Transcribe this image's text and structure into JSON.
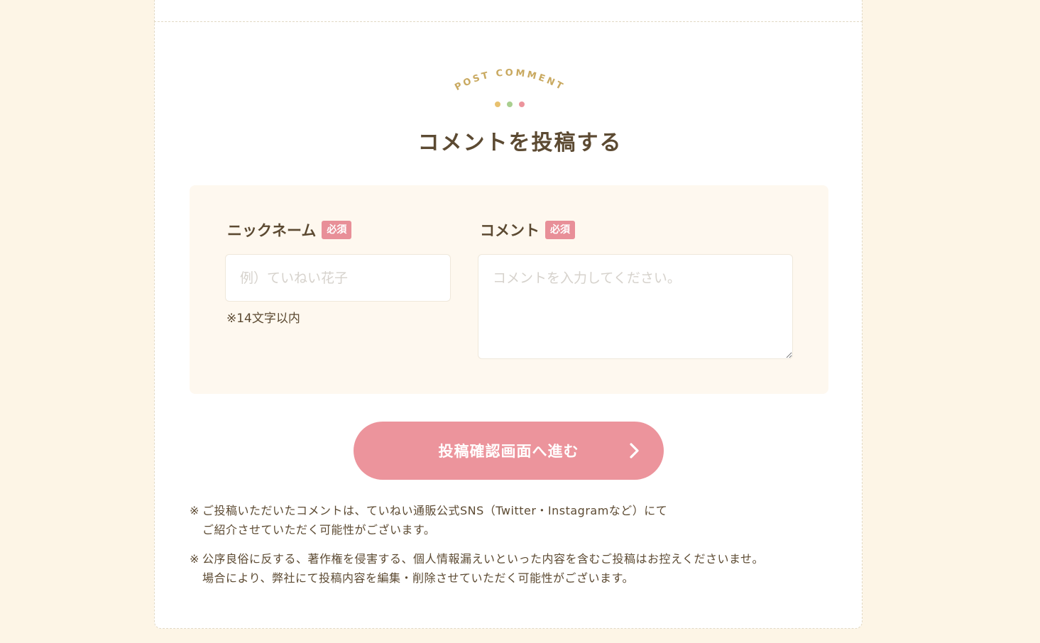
{
  "section": {
    "eyebrow": "POST COMMENT",
    "title": "コメントを投稿する",
    "dot_colors": [
      "#e8c16f",
      "#a9cf8f",
      "#ec949c"
    ],
    "accent_color": "#ec949c",
    "eyebrow_color": "#c9a960"
  },
  "form": {
    "nickname": {
      "label": "ニックネーム",
      "required_badge": "必須",
      "placeholder": "例）ていねい花子",
      "value": "",
      "hint": "※14文字以内"
    },
    "comment": {
      "label": "コメント",
      "required_badge": "必須",
      "placeholder": "コメントを入力してください。",
      "value": ""
    },
    "submit_label": "投稿確認画面へ進む",
    "submit_icon": "chevron-right-icon"
  },
  "notes": [
    {
      "mark": "※",
      "line1": "ご投稿いただいたコメントは、ていねい通販公式SNS（Twitter・Instagramなど）にて",
      "line2": "ご紹介させていただく可能性がございます。"
    },
    {
      "mark": "※",
      "line1": "公序良俗に反する、著作権を侵害する、個人情報漏えいといった内容を含むご投稿はお控えくださいませ。",
      "line2": "場合により、弊社にて投稿内容を編集・削除させていただく可能性がございます。"
    }
  ]
}
